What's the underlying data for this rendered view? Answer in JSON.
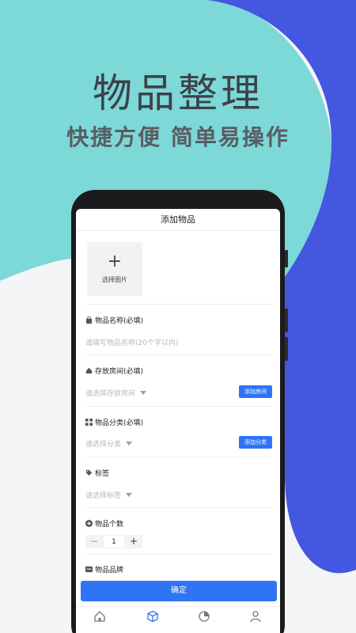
{
  "headline": {
    "title": "物品整理",
    "subtitle": "快捷方便 简单易操作"
  },
  "colors": {
    "teal": "#7dd8d8",
    "blue": "#4457e0",
    "primary": "#2f74f4",
    "page_bg": "#f4f5f7"
  },
  "app": {
    "nav_title": "添加物品",
    "photo": {
      "plus": "+",
      "label": "选择图片"
    },
    "fields": {
      "name": {
        "label": "物品名称(必填)",
        "placeholder": "请填写物品名称(20个字以内)",
        "icon": "bag-icon"
      },
      "room": {
        "label": "存放房间(必填)",
        "placeholder": "请选择存放房间",
        "action": "添加房间",
        "icon": "home-icon"
      },
      "category": {
        "label": "物品分类(必填)",
        "placeholder": "请选择分类",
        "action": "添加分类",
        "icon": "grid-icon"
      },
      "tag": {
        "label": "标签",
        "placeholder": "请选择标签",
        "icon": "tag-icon"
      },
      "count": {
        "label": "物品个数",
        "minus": "−",
        "value": "1",
        "plus": "+",
        "icon": "plus-circle-icon"
      },
      "brand": {
        "label": "物品品牌",
        "icon": "brand-icon"
      }
    },
    "confirm_label": "确定",
    "tabbar": [
      "home-icon",
      "box-icon",
      "chart-icon",
      "user-icon"
    ]
  }
}
